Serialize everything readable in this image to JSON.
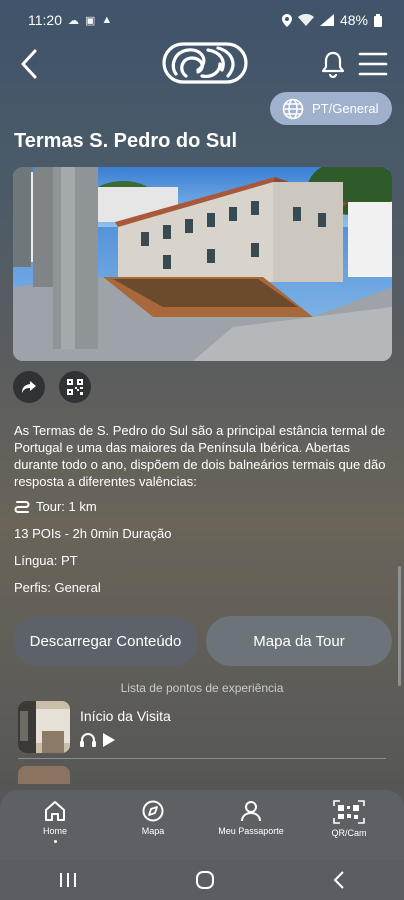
{
  "status": {
    "time": "11:20",
    "battery": "48%"
  },
  "header": {
    "language_label": "PT/General"
  },
  "page": {
    "title": "Termas S. Pedro do Sul",
    "description": "As Termas de S. Pedro do Sul são a principal estância termal de Portugal e uma das maiores da Península Ibérica. Abertas durante todo o ano, dispõem de dois balneários termais que dão resposta a diferentes valências:",
    "tour": "Tour: 1 km",
    "pois_duration": "13 POIs - 2h 0min Duração",
    "language": "Língua: PT",
    "profiles": "Perfis: General"
  },
  "actions": {
    "download_label": "Descarregar Conteúdo",
    "map_label": "Mapa da Tour"
  },
  "poi_list": {
    "caption": "Lista de pontos de experiência",
    "items": [
      {
        "title": "Início da Visita"
      }
    ]
  },
  "bottom_nav": {
    "items": [
      {
        "label": "Home"
      },
      {
        "label": "Mapa"
      },
      {
        "label": "Meu Passaporte"
      },
      {
        "label": "QR/Cam"
      }
    ]
  },
  "colors": {
    "pill_bg": "#9fb1cd",
    "button_dark": "#5d6169",
    "button_map": "#6c7479",
    "nav_bg": "#5d6166"
  }
}
